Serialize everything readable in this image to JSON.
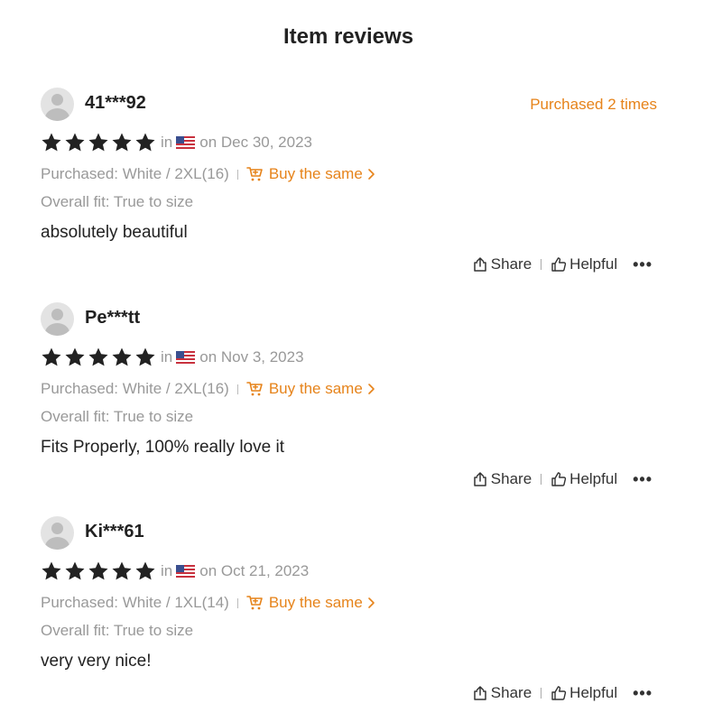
{
  "page": {
    "title": "Item reviews"
  },
  "labels": {
    "in": "in",
    "buy_same": "Buy the same",
    "share": "Share",
    "helpful": "Helpful",
    "more": "•••"
  },
  "colors": {
    "accent": "#e6831a",
    "muted": "#999999",
    "text": "#222222",
    "star": "#222222"
  },
  "reviews": [
    {
      "username": "41***92",
      "purchased_times": "Purchased 2 times",
      "rating": 5,
      "country_flag": "us-flag-icon",
      "date": "on Dec 30, 2023",
      "purchase": "Purchased: White / 2XL(16)",
      "fit": "Overall fit: True to size",
      "comment": "absolutely beautiful"
    },
    {
      "username": "Pe***tt",
      "purchased_times": "",
      "rating": 5,
      "country_flag": "us-flag-icon",
      "date": "on Nov 3, 2023",
      "purchase": "Purchased: White / 2XL(16)",
      "fit": "Overall fit: True to size",
      "comment": "Fits Properly, 100% really love it"
    },
    {
      "username": "Ki***61",
      "purchased_times": "",
      "rating": 5,
      "country_flag": "us-flag-icon",
      "date": "on Oct 21, 2023",
      "purchase": "Purchased: White / 1XL(14)",
      "fit": "Overall fit: True to size",
      "comment": "very very nice!"
    }
  ]
}
